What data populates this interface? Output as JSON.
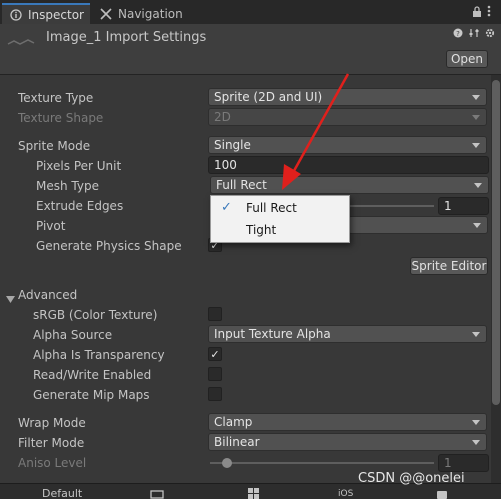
{
  "tabs": [
    {
      "label": "Inspector",
      "icon": "info-icon",
      "active": true
    },
    {
      "label": "Navigation",
      "icon": "navigation-icon",
      "active": false
    }
  ],
  "header": {
    "title": "Image_1 Import Settings",
    "open_label": "Open"
  },
  "texture": {
    "texture_type_label": "Texture Type",
    "texture_type_value": "Sprite (2D and UI)",
    "texture_shape_label": "Texture Shape",
    "texture_shape_value": "2D"
  },
  "sprite": {
    "sprite_mode_label": "Sprite Mode",
    "sprite_mode_value": "Single",
    "ppu_label": "Pixels Per Unit",
    "ppu_value": "100",
    "mesh_type_label": "Mesh Type",
    "mesh_type_value": "Full Rect",
    "extrude_label": "Extrude Edges",
    "extrude_value": "1",
    "pivot_label": "Pivot",
    "physics_label": "Generate Physics Shape",
    "physics_checked": true,
    "sprite_editor_label": "Sprite Editor"
  },
  "popup": {
    "items": [
      {
        "label": "Full Rect",
        "selected": true
      },
      {
        "label": "Tight",
        "selected": false
      }
    ]
  },
  "advanced": {
    "header_label": "Advanced",
    "srgb_label": "sRGB (Color Texture)",
    "srgb_checked": false,
    "alpha_source_label": "Alpha Source",
    "alpha_source_value": "Input Texture Alpha",
    "alpha_transparency_label": "Alpha Is Transparency",
    "alpha_transparency_checked": true,
    "readwrite_label": "Read/Write Enabled",
    "readwrite_checked": false,
    "mipmaps_label": "Generate Mip Maps",
    "mipmaps_checked": false
  },
  "wrap": {
    "wrap_mode_label": "Wrap Mode",
    "wrap_mode_value": "Clamp",
    "filter_mode_label": "Filter Mode",
    "filter_mode_value": "Bilinear",
    "aniso_label": "Aniso Level",
    "aniso_value": "1"
  },
  "footer": {
    "default_label": "Default",
    "ios_label": "iOS"
  },
  "watermark": "CSDN @@onelei",
  "colors": {
    "accent": "#3a79bb",
    "arrow": "#e0201c"
  }
}
